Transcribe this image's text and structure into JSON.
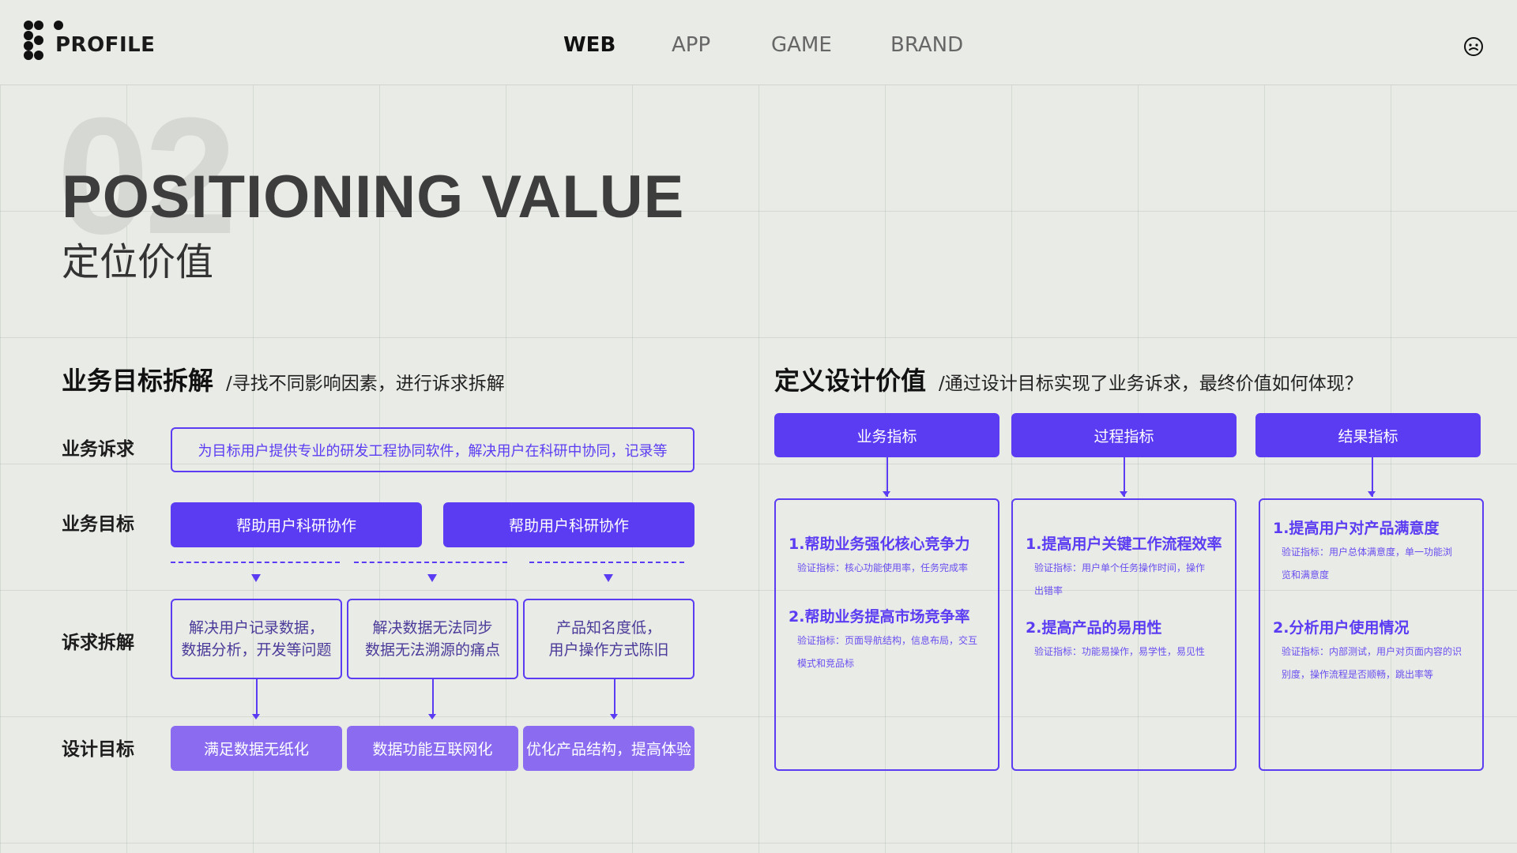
{
  "header": {
    "logo_text": "PROFILE",
    "nav": [
      "WEB",
      "APP",
      "GAME",
      "BRAND"
    ],
    "active_nav": "WEB"
  },
  "hero": {
    "number": "02",
    "title": "POSITIONING VALUE",
    "subtitle": "定位价值"
  },
  "left": {
    "title": "业务目标拆解",
    "desc": "/寻找不同影响因素，进行诉求拆解",
    "rows": {
      "demand": "业务诉求",
      "goal": "业务目标",
      "breakdown": "诉求拆解",
      "design": "设计目标"
    },
    "demand_text": "为目标用户提供专业的研发工程协同软件，解决用户在科研中协同，记录等",
    "goals": [
      "帮助用户科研协作",
      "帮助用户科研协作"
    ],
    "breakdowns": [
      [
        "解决用户记录数据，",
        "数据分析，开发等问题"
      ],
      [
        "解决数据无法同步",
        "数据无法溯源的痛点"
      ],
      [
        "产品知名度低，",
        "用户操作方式陈旧"
      ]
    ],
    "design_goals": [
      "满足数据无纸化",
      "数据功能互联网化",
      "优化产品结构，提高体验"
    ]
  },
  "right": {
    "title": "定义设计价值",
    "desc": "/通过设计目标实现了业务诉求，最终价值如何体现？",
    "headers": [
      "业务指标",
      "过程指标",
      "结果指标"
    ],
    "cards": [
      {
        "items": [
          {
            "title": "1.帮助业务强化核心竞争力",
            "desc": [
              "验证指标：核心功能使用率，任务完成率"
            ]
          },
          {
            "title": "2.帮助业务提高市场竞争率",
            "desc": [
              "验证指标：页面导航结构，信息布局，交互",
              "模式和竞品标"
            ]
          }
        ]
      },
      {
        "items": [
          {
            "title": "1.提高用户关键工作流程效率",
            "desc": [
              "验证指标：用户单个任务操作时间，操作",
              "出错率"
            ]
          },
          {
            "title": "2.提高产品的易用性",
            "desc": [
              "验证指标：功能易操作，易学性，易见性"
            ]
          }
        ]
      },
      {
        "items": [
          {
            "title": "1.提高用户对产品满意度",
            "desc": [
              "验证指标：用户总体满意度，单一功能浏",
              "览和满意度"
            ]
          },
          {
            "title": "2.分析用户使用情况",
            "desc": [
              "验证指标：内部测试，用户对页面内容的识",
              "别度，操作流程是否顺畅，跳出率等"
            ]
          }
        ]
      }
    ]
  },
  "colors": {
    "accent": "#5c3cf2",
    "accent_light": "#8b6cf0",
    "background": "#e8ebe6"
  },
  "icons": {
    "logo": "profile-logo-icon",
    "user": "face-icon"
  }
}
